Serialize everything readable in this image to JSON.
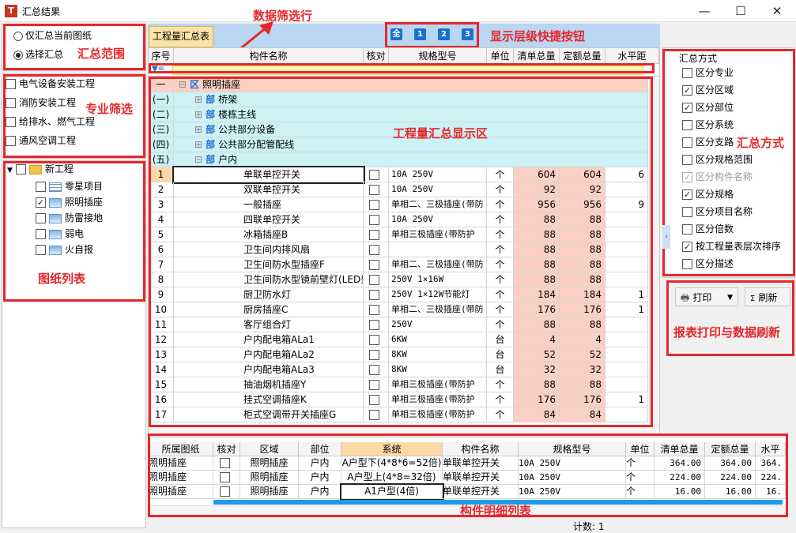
{
  "window": {
    "title": "汇总结果",
    "min": "—",
    "max": "☐",
    "close": "✕"
  },
  "left": {
    "scope_radios": [
      {
        "label": "仅汇总当前图纸",
        "on": false
      },
      {
        "label": "选择汇总",
        "on": true
      }
    ],
    "scope_note": "汇总范围",
    "specialty_items": [
      "电气设备安装工程",
      "消防安装工程",
      "给排水、燃气工程",
      "通风空调工程"
    ],
    "specialty_note": "专业筛选",
    "tree": {
      "root": "新工程",
      "children": [
        {
          "label": "零星项目",
          "checked": false,
          "icon": "grid"
        },
        {
          "label": "照明插座",
          "checked": true,
          "icon": "img"
        },
        {
          "label": "防雷接地",
          "checked": false,
          "icon": "img"
        },
        {
          "label": "弱电",
          "checked": false,
          "icon": "img"
        },
        {
          "label": "火自报",
          "checked": false,
          "icon": "img"
        }
      ]
    },
    "tree_note": "图纸列表"
  },
  "toolbar": {
    "tab": "工程量汇总表",
    "level_buttons": [
      "全",
      "1",
      "2",
      "3"
    ],
    "filter_note": "数据筛选行",
    "level_note": "显示层级快捷按钮"
  },
  "grid": {
    "columns": [
      "序号",
      "构件名称",
      "核对",
      "规格型号",
      "单位",
      "清单总量",
      "定额总量",
      "水平距"
    ],
    "area_note": "工程量汇总显示区",
    "groups": [
      {
        "no": "一",
        "name": "照明插座",
        "tag": "区"
      },
      {
        "no": "(一)",
        "name": "桥架",
        "tag": "部"
      },
      {
        "no": "(二)",
        "name": "楼栋主线",
        "tag": "部"
      },
      {
        "no": "(三)",
        "name": "公共部分设备",
        "tag": "部"
      },
      {
        "no": "(四)",
        "name": "公共部分配管配线",
        "tag": "部"
      },
      {
        "no": "(五)",
        "name": "户内",
        "tag": "部"
      }
    ],
    "rows": [
      {
        "no": "1",
        "name": "单联单控开关",
        "spec": "10A 250V",
        "unit": "个",
        "q1": "604",
        "q2": "604",
        "q3": "6"
      },
      {
        "no": "2",
        "name": "双联单控开关",
        "spec": "10A 250V",
        "unit": "个",
        "q1": "92",
        "q2": "92",
        "q3": ""
      },
      {
        "no": "3",
        "name": "一般插座",
        "spec": "单相二、三极插座(带防",
        "unit": "个",
        "q1": "956",
        "q2": "956",
        "q3": "9"
      },
      {
        "no": "4",
        "name": "四联单控开关",
        "spec": "10A 250V",
        "unit": "个",
        "q1": "88",
        "q2": "88",
        "q3": ""
      },
      {
        "no": "5",
        "name": "冰箱插座B",
        "spec": "单相三极插座(带防护",
        "unit": "个",
        "q1": "88",
        "q2": "88",
        "q3": ""
      },
      {
        "no": "6",
        "name": "卫生间内排风扇",
        "spec": "",
        "unit": "个",
        "q1": "88",
        "q2": "88",
        "q3": ""
      },
      {
        "no": "7",
        "name": "卫生间防水型插座F",
        "spec": "单相二、三极插座(带防",
        "unit": "个",
        "q1": "88",
        "q2": "88",
        "q3": ""
      },
      {
        "no": "8",
        "name": "卫生间防水型镜前壁灯(LED型)",
        "spec": "250V 1×16W",
        "unit": "个",
        "q1": "88",
        "q2": "88",
        "q3": ""
      },
      {
        "no": "9",
        "name": "厨卫防水灯",
        "spec": "250V 1×12W节能灯",
        "unit": "个",
        "q1": "184",
        "q2": "184",
        "q3": "1"
      },
      {
        "no": "10",
        "name": "厨房插座C",
        "spec": "单相二、三极插座(带防",
        "unit": "个",
        "q1": "176",
        "q2": "176",
        "q3": "1"
      },
      {
        "no": "11",
        "name": "客厅组合灯",
        "spec": "250V",
        "unit": "个",
        "q1": "88",
        "q2": "88",
        "q3": ""
      },
      {
        "no": "12",
        "name": "户内配电箱ALa1",
        "spec": "6KW",
        "unit": "台",
        "q1": "4",
        "q2": "4",
        "q3": ""
      },
      {
        "no": "13",
        "name": "户内配电箱ALa2",
        "spec": "8KW",
        "unit": "台",
        "q1": "52",
        "q2": "52",
        "q3": ""
      },
      {
        "no": "14",
        "name": "户内配电箱ALa3",
        "spec": "8KW",
        "unit": "台",
        "q1": "32",
        "q2": "32",
        "q3": ""
      },
      {
        "no": "15",
        "name": "抽油烟机插座Y",
        "spec": "单相三极插座(带防护",
        "unit": "个",
        "q1": "88",
        "q2": "88",
        "q3": ""
      },
      {
        "no": "16",
        "name": "挂式空调插座K",
        "spec": "单相三极插座(带防护",
        "unit": "个",
        "q1": "176",
        "q2": "176",
        "q3": "1"
      },
      {
        "no": "17",
        "name": "柜式空调带开关插座G",
        "spec": "单相三极插座(带防护",
        "unit": "个",
        "q1": "84",
        "q2": "84",
        "q3": ""
      }
    ]
  },
  "detail": {
    "columns": [
      "所属图纸",
      "核对",
      "区域",
      "部位",
      "系统",
      "构件名称",
      "规格型号",
      "单位",
      "清单总量",
      "定额总量",
      "水平"
    ],
    "rows": [
      [
        "照明插座",
        "",
        "照明插座",
        "户内",
        "A户型下(4*8*6=52倍)",
        "单联单控开关",
        "10A 250V",
        "个",
        "364.00",
        "364.00",
        "364."
      ],
      [
        "照明插座",
        "",
        "照明插座",
        "户内",
        "A户型上(4*8=32倍)",
        "单联单控开关",
        "10A 250V",
        "个",
        "224.00",
        "224.00",
        "224."
      ],
      [
        "照明插座",
        "",
        "照明插座",
        "户内",
        "A1户型(4倍)",
        "单联单控开关",
        "10A 250V",
        "个",
        "16.00",
        "16.00",
        "16."
      ]
    ],
    "note": "构件明细列表"
  },
  "right": {
    "title": "汇总方式",
    "options": [
      {
        "label": "区分专业",
        "checked": false,
        "disabled": false
      },
      {
        "label": "区分区域",
        "checked": true,
        "disabled": false
      },
      {
        "label": "区分部位",
        "checked": true,
        "disabled": false
      },
      {
        "label": "区分系统",
        "checked": false,
        "disabled": false
      },
      {
        "label": "区分支路",
        "checked": false,
        "disabled": false
      },
      {
        "label": "区分规格范围",
        "checked": false,
        "disabled": false
      },
      {
        "label": "区分构件名称",
        "checked": true,
        "disabled": true
      },
      {
        "label": "区分规格",
        "checked": true,
        "disabled": false
      },
      {
        "label": "区分项目名称",
        "checked": false,
        "disabled": false
      },
      {
        "label": "区分倍数",
        "checked": false,
        "disabled": false
      },
      {
        "label": "按工程量表层次排序",
        "checked": true,
        "disabled": false
      },
      {
        "label": "区分描述",
        "checked": false,
        "disabled": false
      }
    ],
    "mode_note": "汇总方式",
    "print_label": "打印",
    "refresh_label": "刷新",
    "print_note": "报表打印与数据刷新"
  },
  "status": {
    "count": "计数: 1"
  }
}
